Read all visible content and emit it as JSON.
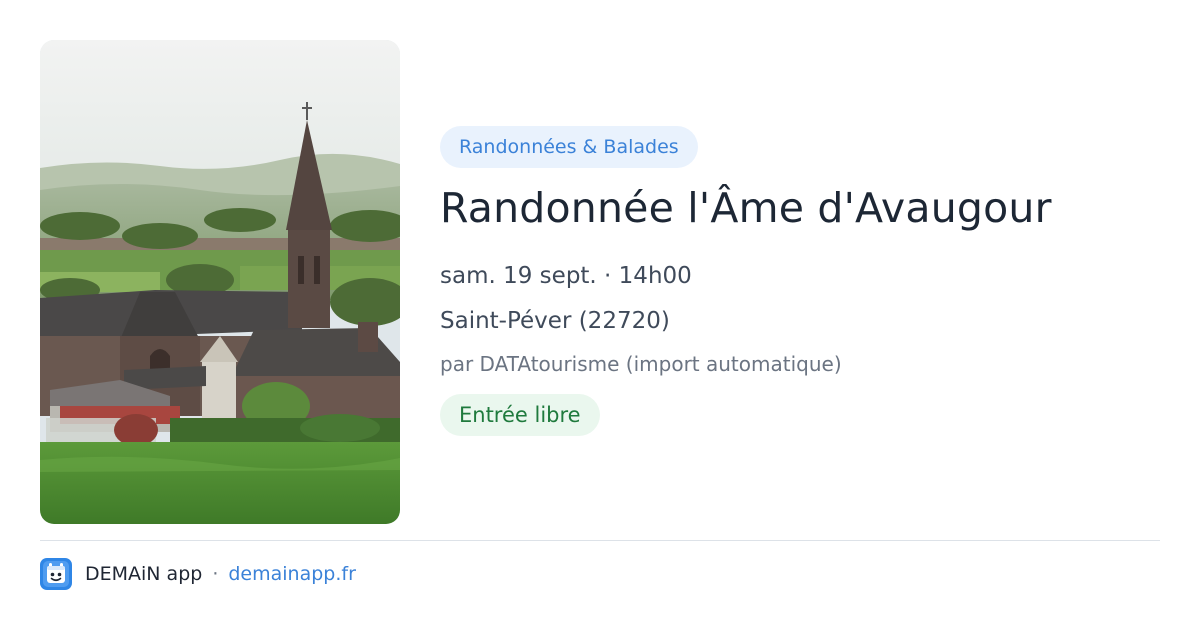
{
  "event": {
    "category": "Randonnées & Balades",
    "title": "Randonnée l'Âme d'Avaugour",
    "datetime": "sam. 19 sept. · 14h00",
    "location": "Saint-Péver (22720)",
    "organizer": "par DATAtourisme (import automatique)",
    "price": "Entrée libre",
    "photo_icon": "church-landscape-photo"
  },
  "footer": {
    "logo_icon": "demain-app-logo-icon",
    "app_name": "DEMAiN app",
    "separator": "·",
    "url": "demainapp.fr"
  },
  "colors": {
    "accent": "#3b82d8",
    "category_bg": "#e9f2fd",
    "price_text": "#1f7a3d",
    "price_bg": "#eaf7ee",
    "title": "#1d2735"
  }
}
